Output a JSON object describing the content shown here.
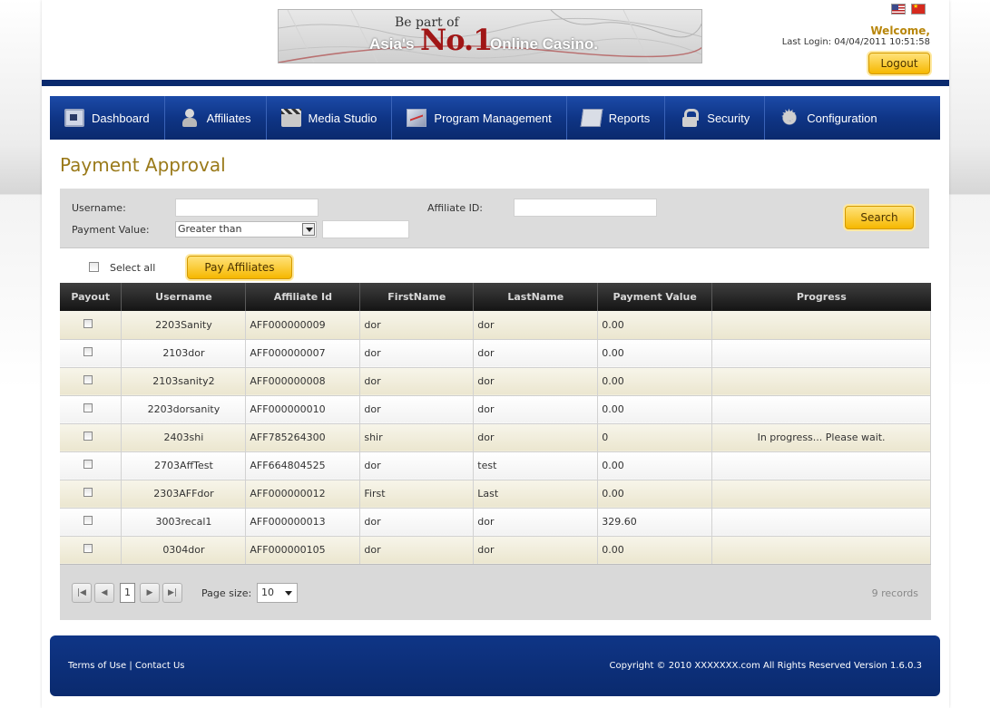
{
  "header": {
    "banner": {
      "line1": "Be part of",
      "line2_prefix": "Asia's",
      "line2_highlight": "No.1",
      "line2_suffix": "Online Casino."
    },
    "languages": [
      "english-flag",
      "chinese-flag"
    ],
    "welcome": "Welcome,",
    "last_login": "Last Login: 04/04/2011 10:51:58",
    "logout_label": "Logout"
  },
  "nav": {
    "items": [
      {
        "label": "Dashboard",
        "icon": "dashboard-icon"
      },
      {
        "label": "Affiliates",
        "icon": "affiliates-icon"
      },
      {
        "label": "Media Studio",
        "icon": "media-studio-icon"
      },
      {
        "label": "Program Management",
        "icon": "program-management-icon"
      },
      {
        "label": "Reports",
        "icon": "reports-icon"
      },
      {
        "label": "Security",
        "icon": "lock-icon"
      },
      {
        "label": "Configuration",
        "icon": "gear-icon"
      }
    ]
  },
  "page_title": "Payment Approval",
  "search": {
    "username_label": "Username:",
    "username_value": "",
    "affiliate_id_label": "Affiliate ID:",
    "affiliate_id_value": "",
    "payment_value_label": "Payment Value:",
    "payment_operator": "Greater than",
    "payment_value": "",
    "search_label": "Search"
  },
  "actions": {
    "select_all_label": "Select all",
    "pay_affiliates_label": "Pay Affiliates"
  },
  "table": {
    "columns": [
      "Payout",
      "Username",
      "Affiliate Id",
      "FirstName",
      "LastName",
      "Payment Value",
      "Progress"
    ],
    "rows": [
      {
        "username": "2203Sanity",
        "affiliate_id": "AFF000000009",
        "first_name": "dor",
        "last_name": "dor",
        "payment_value": "0.00",
        "progress": ""
      },
      {
        "username": "2103dor",
        "affiliate_id": "AFF000000007",
        "first_name": "dor",
        "last_name": "dor",
        "payment_value": "0.00",
        "progress": ""
      },
      {
        "username": "2103sanity2",
        "affiliate_id": "AFF000000008",
        "first_name": "dor",
        "last_name": "dor",
        "payment_value": "0.00",
        "progress": ""
      },
      {
        "username": "2203dorsanity",
        "affiliate_id": "AFF000000010",
        "first_name": "dor",
        "last_name": "dor",
        "payment_value": "0.00",
        "progress": ""
      },
      {
        "username": "2403shi",
        "affiliate_id": "AFF785264300",
        "first_name": "shir",
        "last_name": "dor",
        "payment_value": "0",
        "progress": "In progress... Please wait."
      },
      {
        "username": "2703AffTest",
        "affiliate_id": "AFF664804525",
        "first_name": "dor",
        "last_name": "test",
        "payment_value": "0.00",
        "progress": ""
      },
      {
        "username": "2303AFFdor",
        "affiliate_id": "AFF000000012",
        "first_name": "First",
        "last_name": "Last",
        "payment_value": "0.00",
        "progress": ""
      },
      {
        "username": "3003recal1",
        "affiliate_id": "AFF000000013",
        "first_name": "dor",
        "last_name": "dor",
        "payment_value": "329.60",
        "progress": ""
      },
      {
        "username": "0304dor",
        "affiliate_id": "AFF000000105",
        "first_name": "dor",
        "last_name": "dor",
        "payment_value": "0.00",
        "progress": ""
      }
    ]
  },
  "pager": {
    "current_page": "1",
    "page_size_label": "Page size:",
    "page_size": "10",
    "records": "9 records"
  },
  "footer": {
    "terms_label": "Terms of Use",
    "separator": "|",
    "contact_label": "Contact Us",
    "copyright": "Copyright © 2010 XXXXXXX.com All Rights Reserved  Version 1.6.0.3"
  },
  "colors": {
    "nav_blue": "#0f3586",
    "title_gold": "#9a7a1a",
    "button_gold": "#f6b800",
    "header_dark": "#141414"
  }
}
